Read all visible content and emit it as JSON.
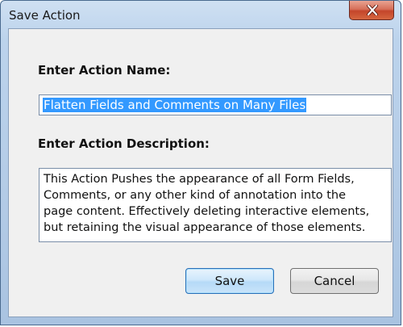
{
  "window": {
    "title": "Save Action"
  },
  "form": {
    "name_label": "Enter Action Name:",
    "name_value": "Flatten Fields and Comments on Many Files",
    "description_label": "Enter Action Description:",
    "description_lines": [
      "This Action Pushes the appearance of all Form Fields,",
      "Comments, or any other kind of annotation into the",
      "page content.  Effectively deleting interactive elements,",
      "but retaining the visual appearance of those elements."
    ]
  },
  "buttons": {
    "save_label": "Save",
    "cancel_label": "Cancel"
  },
  "icons": {
    "close": "close-icon"
  },
  "colors": {
    "selection": "#3399ff",
    "close_button": "#c4452b",
    "titlebar": "#b3cbe6"
  }
}
